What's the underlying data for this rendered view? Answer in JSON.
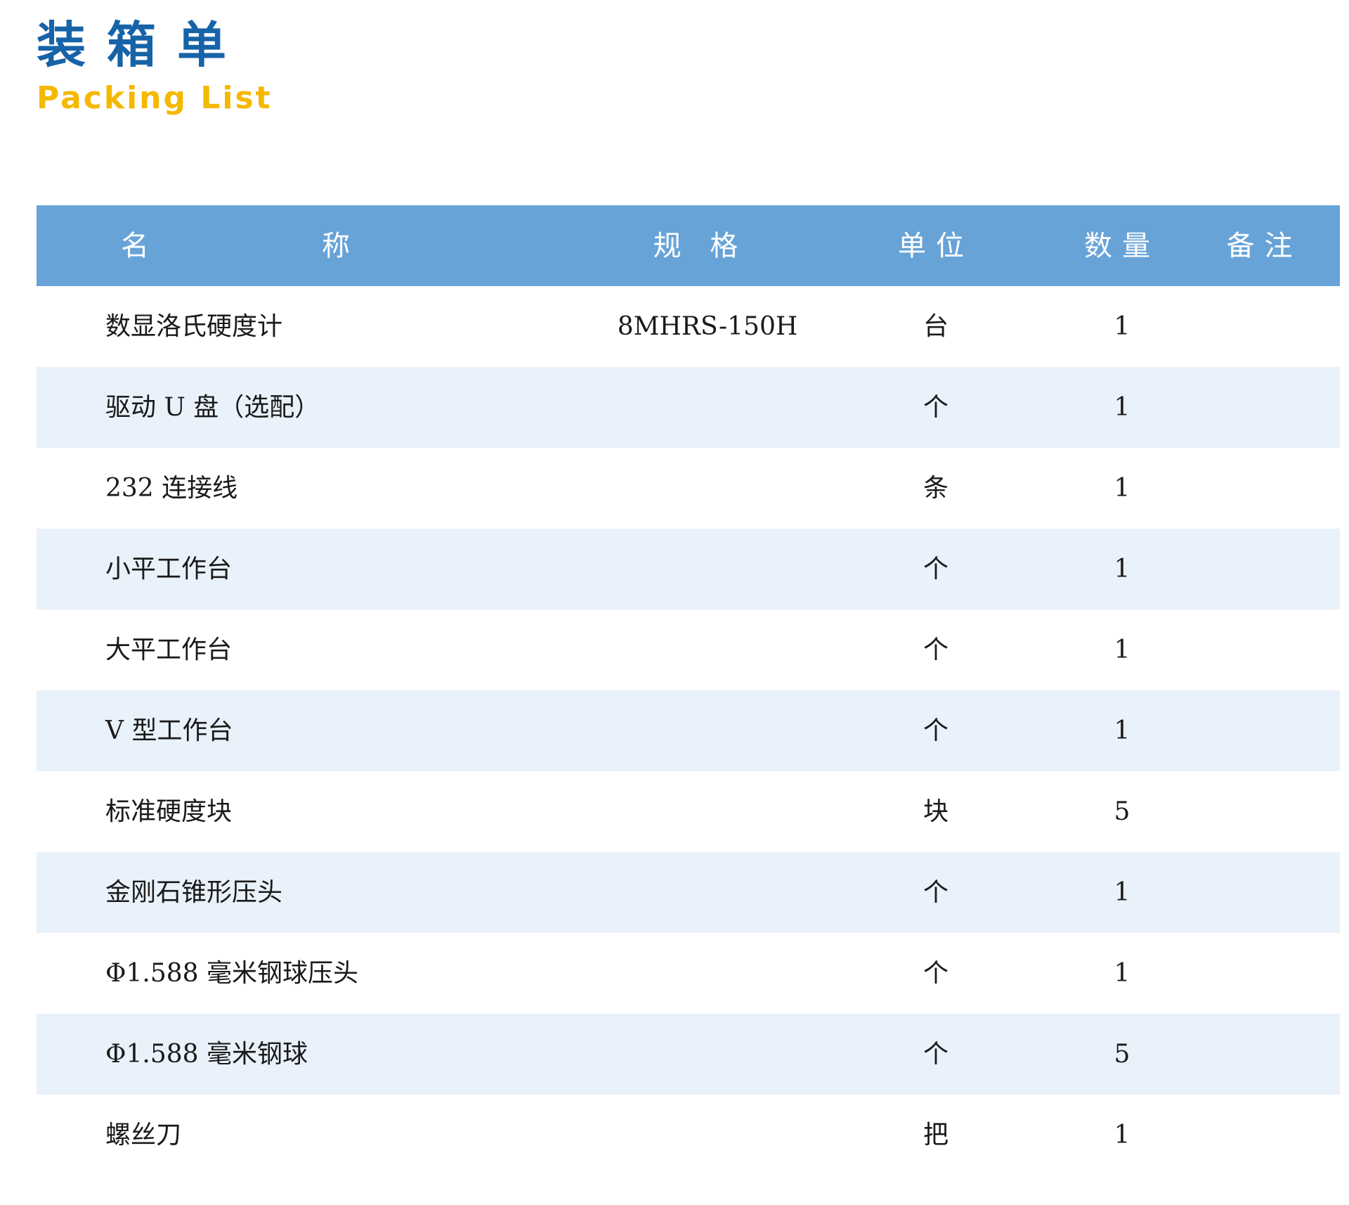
{
  "title": {
    "cn": "装箱单",
    "en": "Packing List"
  },
  "table": {
    "headers": {
      "name_left": "名",
      "name_right": "称",
      "spec": "规 格",
      "unit": "单位",
      "qty": "数量",
      "note": "备注"
    },
    "rows": [
      {
        "name": "数显洛氏硬度计",
        "spec": "8MHRS-150H",
        "unit": "台",
        "qty": "1",
        "note": ""
      },
      {
        "name": "驱动 U 盘（选配）",
        "spec": "",
        "unit": "个",
        "qty": "1",
        "note": ""
      },
      {
        "name": "232 连接线",
        "spec": "",
        "unit": "条",
        "qty": "1",
        "note": ""
      },
      {
        "name": "小平工作台",
        "spec": "",
        "unit": "个",
        "qty": "1",
        "note": ""
      },
      {
        "name": "大平工作台",
        "spec": "",
        "unit": "个",
        "qty": "1",
        "note": ""
      },
      {
        "name": "V 型工作台",
        "spec": "",
        "unit": "个",
        "qty": "1",
        "note": ""
      },
      {
        "name": "标准硬度块",
        "spec": "",
        "unit": "块",
        "qty": "5",
        "note": ""
      },
      {
        "name": "金刚石锥形压头",
        "spec": "",
        "unit": "个",
        "qty": "1",
        "note": ""
      },
      {
        "name": "Φ1.588 毫米钢球压头",
        "spec": "",
        "unit": "个",
        "qty": "1",
        "note": ""
      },
      {
        "name": "Φ1.588 毫米钢球",
        "spec": "",
        "unit": "个",
        "qty": "5",
        "note": ""
      },
      {
        "name": "螺丝刀",
        "spec": "",
        "unit": "把",
        "qty": "1",
        "note": ""
      }
    ]
  }
}
